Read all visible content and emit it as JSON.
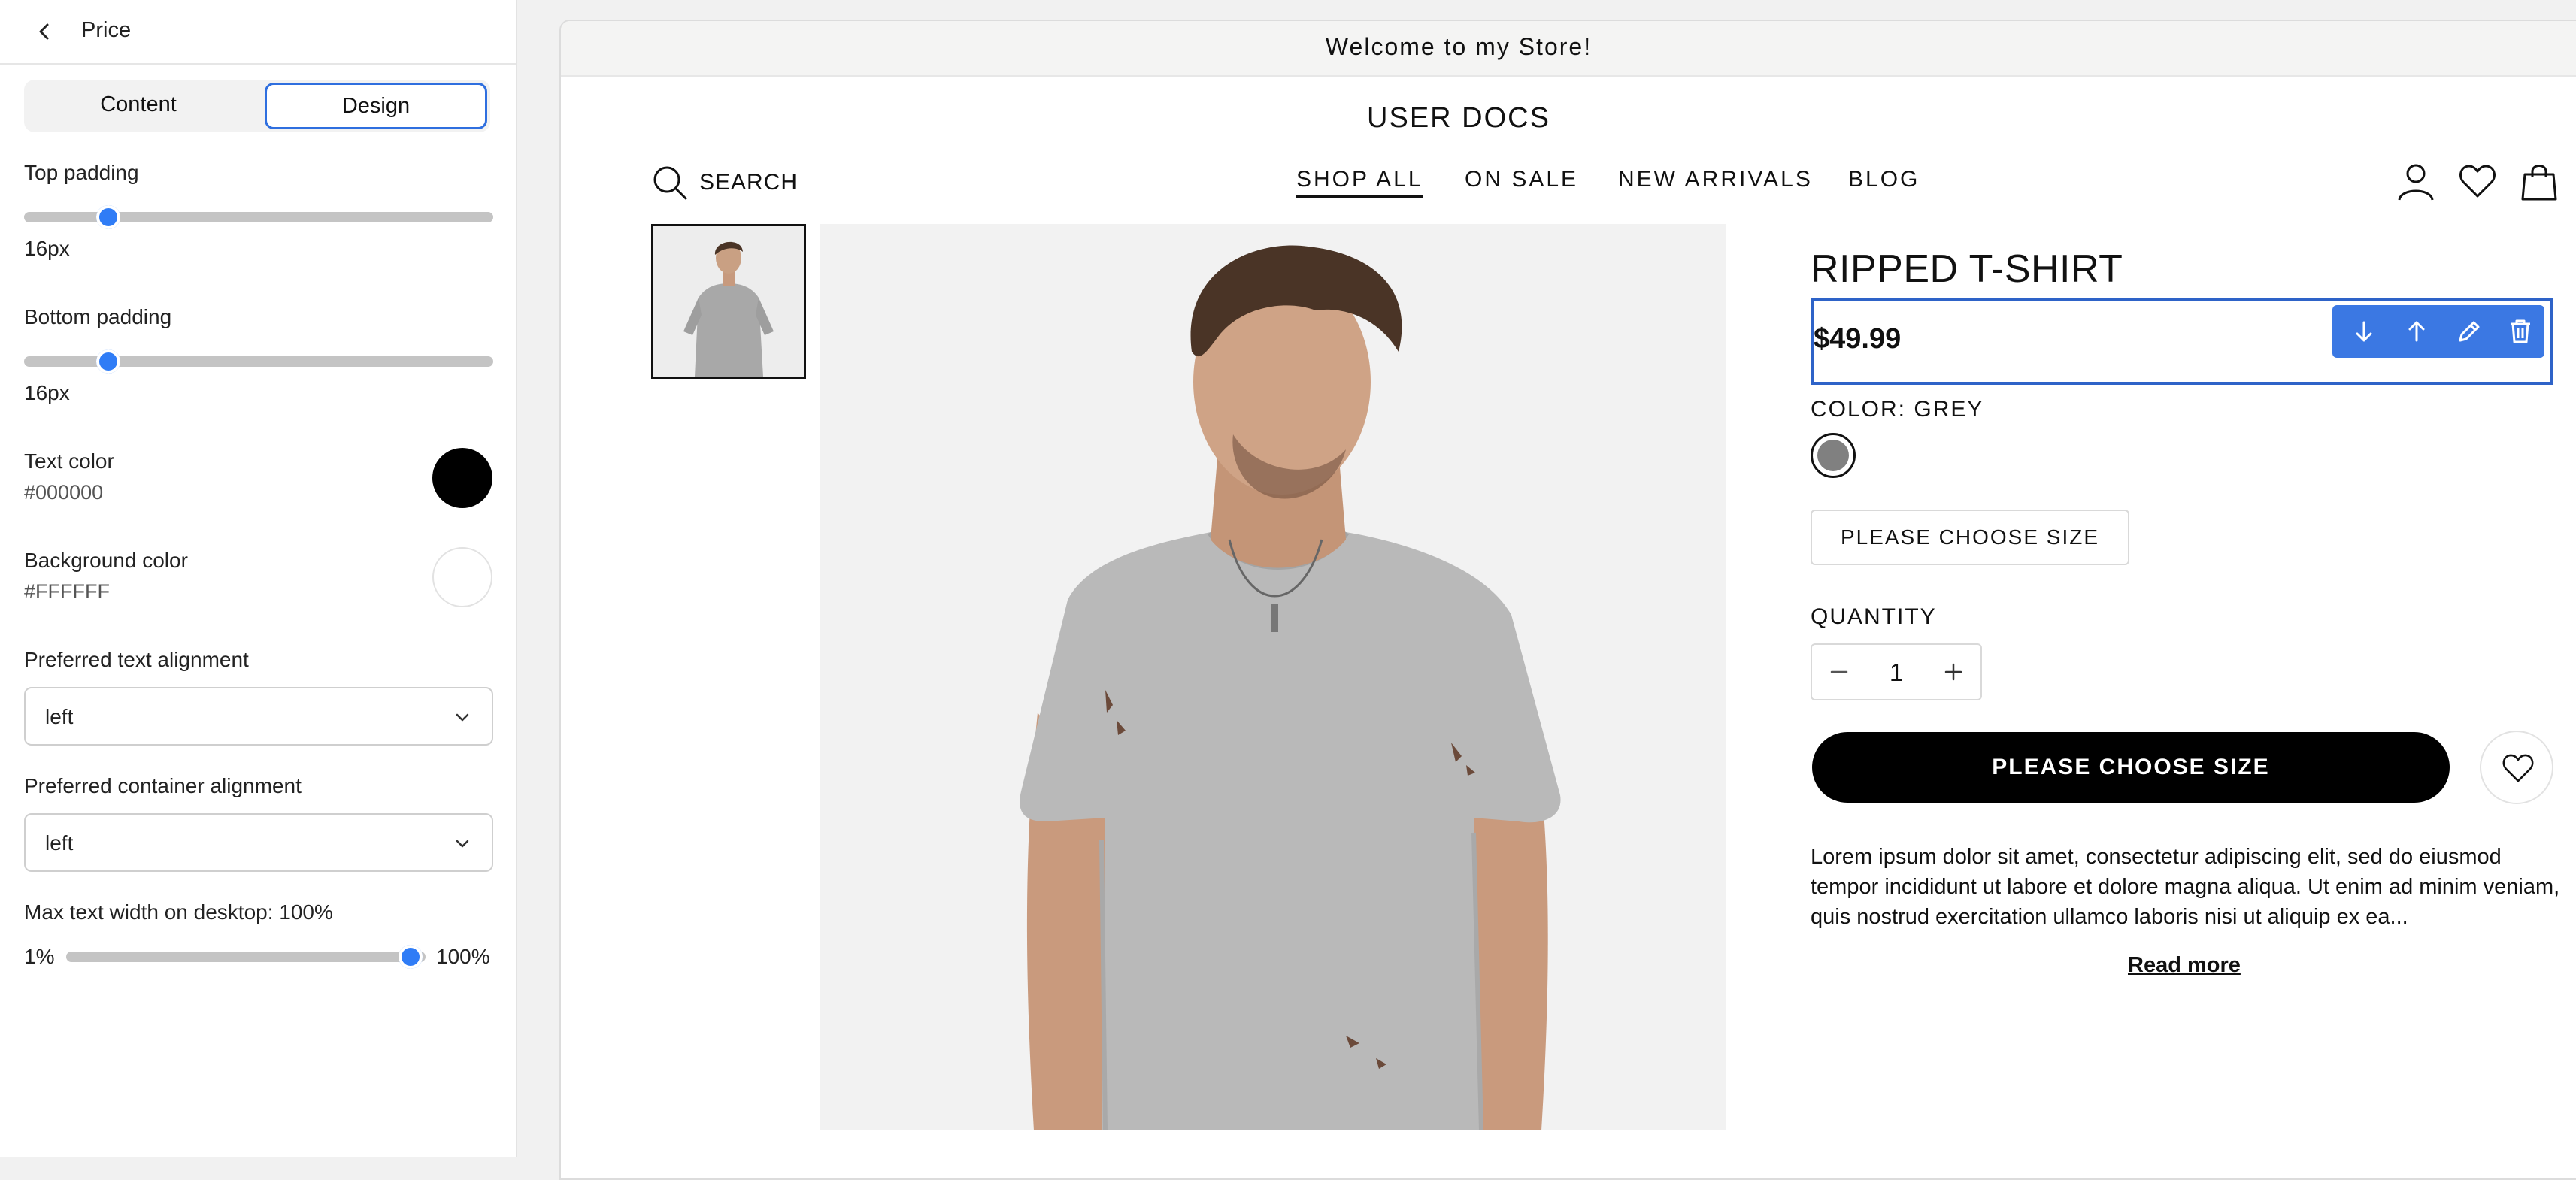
{
  "panel": {
    "title": "Price",
    "tabs": {
      "content": "Content",
      "design": "Design",
      "active": "Design"
    },
    "top_padding": {
      "label": "Top padding",
      "value": "16px",
      "slider_fraction": 0.18
    },
    "bottom_padding": {
      "label": "Bottom padding",
      "value": "16px",
      "slider_fraction": 0.18
    },
    "text_color": {
      "label": "Text color",
      "value": "#000000"
    },
    "background_color": {
      "label": "Background color",
      "value": "#FFFFFF"
    },
    "text_alignment": {
      "label": "Preferred text alignment",
      "value": "left"
    },
    "container_alignment": {
      "label": "Preferred container alignment",
      "value": "left"
    },
    "max_width": {
      "label": "Max text width on desktop: 100%",
      "min_label": "1%",
      "max_label": "100%",
      "percent": 100
    }
  },
  "preview": {
    "announcement": "Welcome to my Store!",
    "store_title": "USER DOCS",
    "search_label": "SEARCH",
    "nav": [
      "SHOP ALL",
      "ON SALE",
      "NEW ARRIVALS",
      "BLOG"
    ],
    "product": {
      "title": "RIPPED T-SHIRT",
      "price": "$49.99",
      "color_label": "COLOR: GREY",
      "color_value": "#808080",
      "size_button": "PLEASE CHOOSE SIZE",
      "quantity_label": "QUANTITY",
      "quantity": "1",
      "add_button": "PLEASE CHOOSE SIZE",
      "description": "Lorem ipsum dolor sit amet, consectetur adipiscing elit, sed do eiusmod tempor incididunt ut labore et dolore magna aliqua. Ut enim ad minim veniam, quis nostrud exercitation ullamco laboris nisi ut aliquip ex ea...",
      "read_more": "Read more"
    }
  },
  "colors": {
    "accent": "#2f7cf6",
    "selection": "#2e63c8",
    "toolbar": "#3b78e3"
  }
}
